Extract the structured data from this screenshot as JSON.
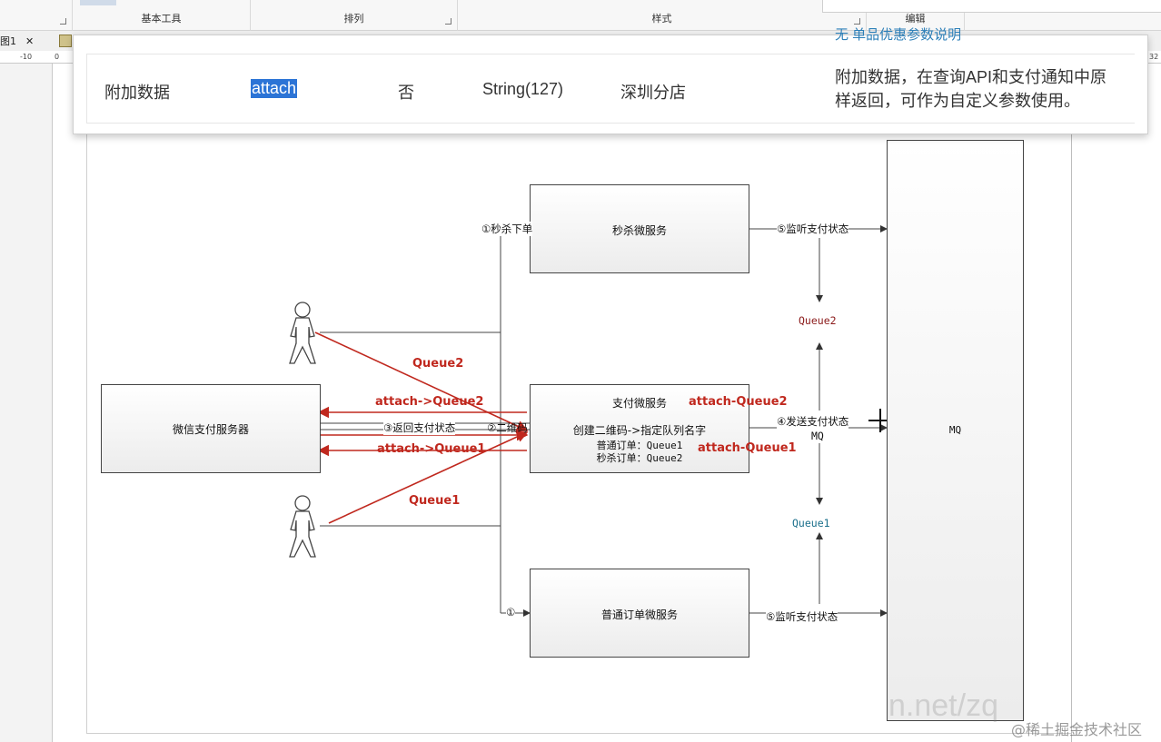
{
  "ribbon": {
    "groups": [
      {
        "label": "基本工具"
      },
      {
        "label": "排列"
      },
      {
        "label": "样式"
      },
      {
        "label": "编辑"
      }
    ]
  },
  "tabs": {
    "doc_tab": "图1",
    "close_glyph": "✕"
  },
  "ruler": {
    "ticks": [
      "-10",
      "0",
      "32"
    ]
  },
  "popup": {
    "top_fragment": "无   单品优惠参数说明",
    "row": {
      "name": "附加数据",
      "field": "attach",
      "required": "否",
      "type": "String(127)",
      "example": "深圳分店",
      "description": "附加数据，在查询API和支付通知中原样返回，可作为自定义参数使用。"
    }
  },
  "diagram": {
    "boxes": {
      "wechat_pay": "微信支付服务器",
      "seckill": "秒杀微服务",
      "pay": "支付微服务",
      "pay_line1": "创建二维码->指定队列名字",
      "pay_line2": "普通订单：Queue1",
      "pay_line3": "秒杀订单：Queue2",
      "order": "普通订单微服务",
      "mq": "MQ"
    },
    "labels": {
      "seckill_order": "①秒杀下单",
      "order_arrow": "①",
      "listen_top": "⑤监听支付状态",
      "listen_bottom": "⑤监听支付状态",
      "send_status": "④发送支付状态",
      "mq_small": "MQ",
      "return_status": "③返回支付状态",
      "qrcode": "②二维码",
      "queue2_small": "Queue2",
      "queue1_small": "Queue1"
    },
    "red_labels": {
      "queue2": "Queue2",
      "queue1": "Queue1",
      "attach_q2_left": "attach->Queue2",
      "attach_q1_left": "attach->Queue1",
      "attach_q2_right": "attach-Queue2",
      "attach_q1_right": "attach-Queue1"
    },
    "colors": {
      "arrow_red": "#c0281e",
      "queue2_text": "#8b1a1a",
      "queue1_text": "#1a6f8b"
    }
  },
  "watermark": {
    "faint": "n.net/zq",
    "brand": "@稀土掘金技术社区"
  }
}
